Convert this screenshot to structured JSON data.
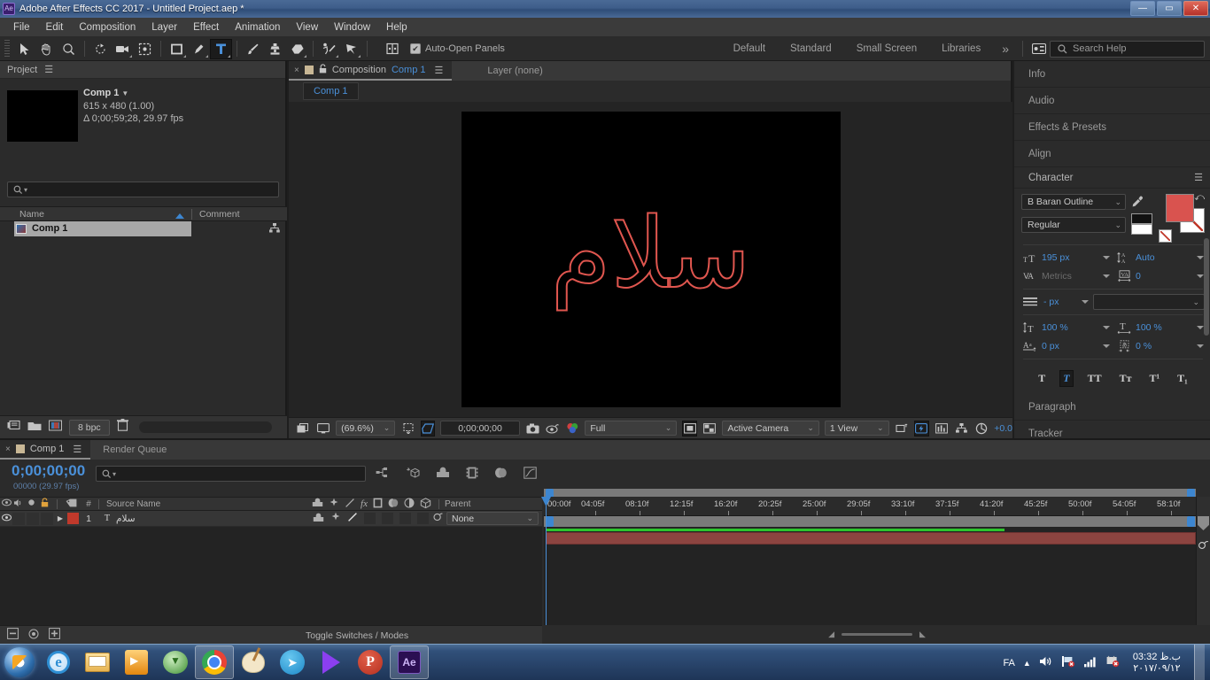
{
  "window": {
    "app_icon": "ae-icon",
    "title": "Adobe After Effects CC 2017 - Untitled Project.aep *",
    "minimize": "—",
    "maximize": "▭",
    "close": "✕"
  },
  "menubar": {
    "items": [
      "File",
      "Edit",
      "Composition",
      "Layer",
      "Effect",
      "Animation",
      "View",
      "Window",
      "Help"
    ]
  },
  "toolbar": {
    "tools": [
      {
        "name": "selection-tool",
        "active": false
      },
      {
        "name": "hand-tool",
        "active": false
      },
      {
        "name": "zoom-tool",
        "active": false
      },
      {
        "name": "rotation-tool",
        "active": false
      },
      {
        "name": "camera-tool",
        "active": false
      },
      {
        "name": "pan-behind-tool",
        "active": false
      },
      {
        "name": "shape-tool",
        "active": false
      },
      {
        "name": "pen-tool",
        "active": false
      },
      {
        "name": "type-tool",
        "active": true
      },
      {
        "name": "brush-tool",
        "active": false
      },
      {
        "name": "clone-stamp-tool",
        "active": false
      },
      {
        "name": "eraser-tool",
        "active": false
      },
      {
        "name": "roto-brush-tool",
        "active": false
      },
      {
        "name": "puppet-pin-tool",
        "active": false
      }
    ],
    "auto_open_panels": "Auto-Open Panels",
    "auto_open_checked": "✔",
    "workspaces": [
      "Default",
      "Standard",
      "Small Screen",
      "Libraries"
    ],
    "overflow": "»",
    "search_placeholder": "Search Help"
  },
  "project": {
    "title": "Project",
    "comp_name": "Comp 1",
    "comp_dimensions": "615 x 480 (1.00)",
    "comp_duration": "Δ 0;00;59;28, 29.97 fps",
    "search_placeholder": "",
    "columns": [
      "Name",
      "Comment"
    ],
    "rows": [
      {
        "name": "Comp 1"
      }
    ],
    "bit_depth": "8 bpc"
  },
  "composition": {
    "tab_close": "×",
    "tab_prefix": "Composition",
    "tab_name": "Comp 1",
    "layer_label": "Layer (none)",
    "sub_tab": "Comp 1",
    "canvas_text": "سلام",
    "canvas_text_color": "#e0564f",
    "canvas_bg": "#000000",
    "footer": {
      "zoom": "(69.6%)",
      "timecode": "0;00;00;00",
      "resolution": "Full",
      "camera": "Active Camera",
      "views": "1 View",
      "exposure": "+0.0"
    }
  },
  "right_dock": {
    "collapsed": [
      "Info",
      "Audio",
      "Effects & Presets",
      "Align"
    ],
    "character": {
      "title": "Character",
      "font_family": "B Baran Outline",
      "font_style": "Regular",
      "font_size": "195 px",
      "leading": "Auto",
      "kerning": "Metrics",
      "tracking": "0",
      "stroke_width": "- px",
      "stroke_type": "",
      "vertical_scale": "100 %",
      "horizontal_scale": "100 %",
      "baseline_shift": "0 px",
      "tsume": "0 %",
      "style_buttons": [
        "T",
        "T",
        "TT",
        "Tт",
        "T¹",
        "T₁"
      ],
      "active_style_index": 1,
      "fill_color": "#d9534f",
      "stroke_color": "#ffffff"
    },
    "below": [
      "Paragraph",
      "Tracker"
    ]
  },
  "timeline": {
    "tab_close": "×",
    "tab_name": "Comp 1",
    "render_queue": "Render Queue",
    "current_time": "0;00;00;00",
    "frame_info": "00000 (29.97 fps)",
    "search_placeholder": "",
    "columns": {
      "source_name": "Source Name",
      "number": "#",
      "parent": "Parent"
    },
    "layers": [
      {
        "index": "1",
        "name": "سلام",
        "type_icon": "T",
        "parent": "None",
        "color": "#c0392b"
      }
    ],
    "toggle_switches": "Toggle Switches / Modes",
    "ruler_ticks": [
      "00:00f",
      "04:05f",
      "08:10f",
      "12:15f",
      "16:20f",
      "20:25f",
      "25:00f",
      "29:05f",
      "33:10f",
      "37:15f",
      "41:20f",
      "45:25f",
      "50:00f",
      "54:05f",
      "58:10f"
    ]
  },
  "taskbar": {
    "items": [
      {
        "name": "start-orb"
      },
      {
        "name": "internet-explorer",
        "glyph": "e"
      },
      {
        "name": "file-explorer"
      },
      {
        "name": "windows-media-player"
      },
      {
        "name": "internet-download-manager"
      },
      {
        "name": "google-chrome",
        "running": true
      },
      {
        "name": "paint"
      },
      {
        "name": "telegram",
        "glyph": "➤"
      },
      {
        "name": "km-player"
      },
      {
        "name": "potplayer",
        "glyph": "P"
      },
      {
        "name": "after-effects",
        "glyph": "Ae",
        "running": true
      }
    ],
    "tray": {
      "language": "FA",
      "show_hidden": "▲",
      "volume": "🔊",
      "network": "📶",
      "signal": "📡",
      "action_center": "⚑",
      "time": "03:32 ب.ظ",
      "date": "۲۰۱۷/۰۹/۱۲"
    }
  }
}
